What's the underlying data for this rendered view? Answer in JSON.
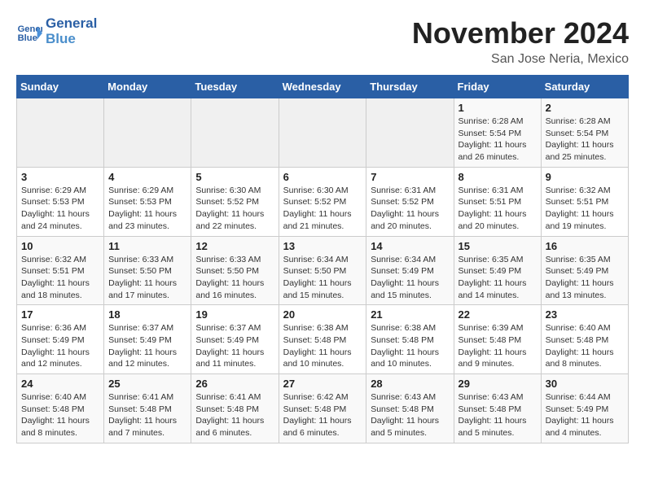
{
  "header": {
    "logo_line1": "General",
    "logo_line2": "Blue",
    "month": "November 2024",
    "location": "San Jose Neria, Mexico"
  },
  "weekdays": [
    "Sunday",
    "Monday",
    "Tuesday",
    "Wednesday",
    "Thursday",
    "Friday",
    "Saturday"
  ],
  "weeks": [
    [
      {
        "day": "",
        "info": ""
      },
      {
        "day": "",
        "info": ""
      },
      {
        "day": "",
        "info": ""
      },
      {
        "day": "",
        "info": ""
      },
      {
        "day": "",
        "info": ""
      },
      {
        "day": "1",
        "info": "Sunrise: 6:28 AM\nSunset: 5:54 PM\nDaylight: 11 hours and 26 minutes."
      },
      {
        "day": "2",
        "info": "Sunrise: 6:28 AM\nSunset: 5:54 PM\nDaylight: 11 hours and 25 minutes."
      }
    ],
    [
      {
        "day": "3",
        "info": "Sunrise: 6:29 AM\nSunset: 5:53 PM\nDaylight: 11 hours and 24 minutes."
      },
      {
        "day": "4",
        "info": "Sunrise: 6:29 AM\nSunset: 5:53 PM\nDaylight: 11 hours and 23 minutes."
      },
      {
        "day": "5",
        "info": "Sunrise: 6:30 AM\nSunset: 5:52 PM\nDaylight: 11 hours and 22 minutes."
      },
      {
        "day": "6",
        "info": "Sunrise: 6:30 AM\nSunset: 5:52 PM\nDaylight: 11 hours and 21 minutes."
      },
      {
        "day": "7",
        "info": "Sunrise: 6:31 AM\nSunset: 5:52 PM\nDaylight: 11 hours and 20 minutes."
      },
      {
        "day": "8",
        "info": "Sunrise: 6:31 AM\nSunset: 5:51 PM\nDaylight: 11 hours and 20 minutes."
      },
      {
        "day": "9",
        "info": "Sunrise: 6:32 AM\nSunset: 5:51 PM\nDaylight: 11 hours and 19 minutes."
      }
    ],
    [
      {
        "day": "10",
        "info": "Sunrise: 6:32 AM\nSunset: 5:51 PM\nDaylight: 11 hours and 18 minutes."
      },
      {
        "day": "11",
        "info": "Sunrise: 6:33 AM\nSunset: 5:50 PM\nDaylight: 11 hours and 17 minutes."
      },
      {
        "day": "12",
        "info": "Sunrise: 6:33 AM\nSunset: 5:50 PM\nDaylight: 11 hours and 16 minutes."
      },
      {
        "day": "13",
        "info": "Sunrise: 6:34 AM\nSunset: 5:50 PM\nDaylight: 11 hours and 15 minutes."
      },
      {
        "day": "14",
        "info": "Sunrise: 6:34 AM\nSunset: 5:49 PM\nDaylight: 11 hours and 15 minutes."
      },
      {
        "day": "15",
        "info": "Sunrise: 6:35 AM\nSunset: 5:49 PM\nDaylight: 11 hours and 14 minutes."
      },
      {
        "day": "16",
        "info": "Sunrise: 6:35 AM\nSunset: 5:49 PM\nDaylight: 11 hours and 13 minutes."
      }
    ],
    [
      {
        "day": "17",
        "info": "Sunrise: 6:36 AM\nSunset: 5:49 PM\nDaylight: 11 hours and 12 minutes."
      },
      {
        "day": "18",
        "info": "Sunrise: 6:37 AM\nSunset: 5:49 PM\nDaylight: 11 hours and 12 minutes."
      },
      {
        "day": "19",
        "info": "Sunrise: 6:37 AM\nSunset: 5:49 PM\nDaylight: 11 hours and 11 minutes."
      },
      {
        "day": "20",
        "info": "Sunrise: 6:38 AM\nSunset: 5:48 PM\nDaylight: 11 hours and 10 minutes."
      },
      {
        "day": "21",
        "info": "Sunrise: 6:38 AM\nSunset: 5:48 PM\nDaylight: 11 hours and 10 minutes."
      },
      {
        "day": "22",
        "info": "Sunrise: 6:39 AM\nSunset: 5:48 PM\nDaylight: 11 hours and 9 minutes."
      },
      {
        "day": "23",
        "info": "Sunrise: 6:40 AM\nSunset: 5:48 PM\nDaylight: 11 hours and 8 minutes."
      }
    ],
    [
      {
        "day": "24",
        "info": "Sunrise: 6:40 AM\nSunset: 5:48 PM\nDaylight: 11 hours and 8 minutes."
      },
      {
        "day": "25",
        "info": "Sunrise: 6:41 AM\nSunset: 5:48 PM\nDaylight: 11 hours and 7 minutes."
      },
      {
        "day": "26",
        "info": "Sunrise: 6:41 AM\nSunset: 5:48 PM\nDaylight: 11 hours and 6 minutes."
      },
      {
        "day": "27",
        "info": "Sunrise: 6:42 AM\nSunset: 5:48 PM\nDaylight: 11 hours and 6 minutes."
      },
      {
        "day": "28",
        "info": "Sunrise: 6:43 AM\nSunset: 5:48 PM\nDaylight: 11 hours and 5 minutes."
      },
      {
        "day": "29",
        "info": "Sunrise: 6:43 AM\nSunset: 5:48 PM\nDaylight: 11 hours and 5 minutes."
      },
      {
        "day": "30",
        "info": "Sunrise: 6:44 AM\nSunset: 5:49 PM\nDaylight: 11 hours and 4 minutes."
      }
    ]
  ]
}
